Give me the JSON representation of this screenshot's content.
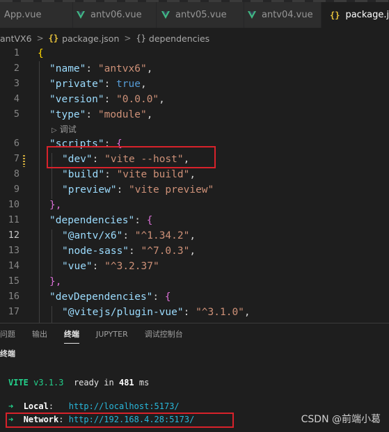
{
  "tabs": [
    {
      "label": "App.vue",
      "icon": "vue-icon",
      "active": false
    },
    {
      "label": "antv06.vue",
      "icon": "vue-icon",
      "active": false
    },
    {
      "label": "antv05.vue",
      "icon": "vue-icon",
      "active": false
    },
    {
      "label": "antv04.vue",
      "icon": "vue-icon",
      "active": false
    },
    {
      "label": "package.json",
      "icon": "json-braces-icon",
      "active": true
    }
  ],
  "breadcrumb": {
    "folder": "antVX6",
    "sep": ">",
    "file_icon": "{}",
    "file": "package.json",
    "node_icon": "{}",
    "node": "dependencies"
  },
  "editor": {
    "line_numbers": [
      "1",
      "2",
      "3",
      "4",
      "5",
      "6",
      "7",
      "8",
      "9",
      "10",
      "11",
      "12",
      "13",
      "14",
      "15",
      "16",
      "17"
    ],
    "current_line": "12",
    "codelens": "调试",
    "lines": {
      "l1": {
        "open": "{"
      },
      "l2": {
        "key": "\"name\"",
        "colon": ": ",
        "value": "\"antvx6\"",
        "comma": ","
      },
      "l3": {
        "key": "\"private\"",
        "colon": ": ",
        "value": "true",
        "comma": ","
      },
      "l4": {
        "key": "\"version\"",
        "colon": ": ",
        "value": "\"0.0.0\"",
        "comma": ","
      },
      "l5": {
        "key": "\"type\"",
        "colon": ": ",
        "value": "\"module\"",
        "comma": ","
      },
      "l6": {
        "key": "\"scripts\"",
        "colon": ": ",
        "open": "{"
      },
      "l7": {
        "key": "\"dev\"",
        "colon": ": ",
        "value": "\"vite --host\"",
        "comma": ","
      },
      "l8": {
        "key": "\"build\"",
        "colon": ": ",
        "value": "\"vite build\"",
        "comma": ","
      },
      "l9": {
        "key": "\"preview\"",
        "colon": ": ",
        "value": "\"vite preview\""
      },
      "l10": {
        "close": "},"
      },
      "l11": {
        "key": "\"dependencies\"",
        "colon": ": ",
        "open": "{"
      },
      "l12": {
        "key": "\"@antv/x6\"",
        "colon": ": ",
        "value": "\"^1.34.2\"",
        "comma": ","
      },
      "l13": {
        "key": "\"node-sass\"",
        "colon": ": ",
        "value": "\"^7.0.3\"",
        "comma": ","
      },
      "l14": {
        "key": "\"vue\"",
        "colon": ": ",
        "value": "\"^3.2.37\""
      },
      "l15": {
        "close": "},"
      },
      "l16": {
        "key": "\"devDependencies\"",
        "colon": ": ",
        "open": "{"
      },
      "l17": {
        "key": "\"@vitejs/plugin-vue\"",
        "colon": ": ",
        "value": "\"^3.1.0\"",
        "comma": ","
      }
    }
  },
  "panel": {
    "tabs": [
      "问题",
      "输出",
      "终端",
      "JUPYTER",
      "调试控制台"
    ],
    "active_tab": "终端",
    "terminal_title": "终端"
  },
  "terminal": {
    "vite_name": "VITE",
    "vite_version": "v3.1.3",
    "ready_prefix": "ready in",
    "ready_ms": "481",
    "ready_suffix": "ms",
    "arrow": "➜",
    "local_label": "Local",
    "local_url": "http://localhost:5173/",
    "network_label": "Network",
    "network_url": "http://192.168.4.28:5173/"
  },
  "watermark": "CSDN @前端小葛",
  "colors": {
    "background": "#1e1e1e",
    "highlight_box": "#d8222b",
    "json_key": "#9cdcfe",
    "json_string": "#ce9178",
    "terminal_green": "#23d18b",
    "terminal_cyan": "#29b8db"
  }
}
